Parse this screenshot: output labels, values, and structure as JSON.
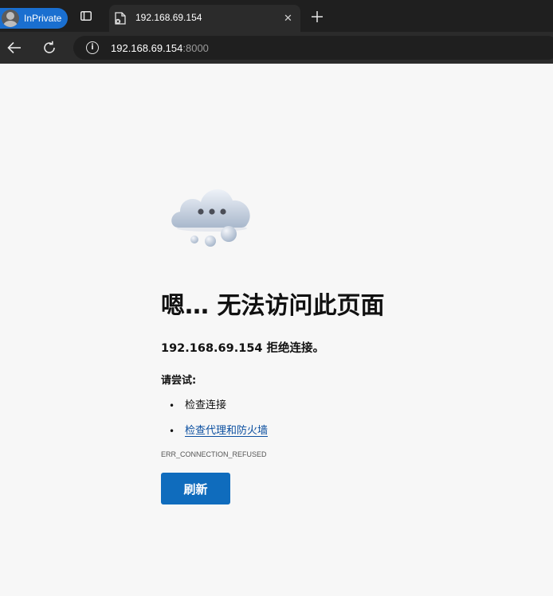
{
  "browser": {
    "inprivate_label": "InPrivate",
    "tab": {
      "title": "192.168.69.154",
      "close_glyph": "✕"
    },
    "address": {
      "host": "192.168.69.154",
      "port": ":8000"
    },
    "accent_color": "#1a6fd0"
  },
  "page": {
    "illustration": "cloud-error-icon",
    "headline": "嗯… 无法访问此页面",
    "subline": "192.168.69.154 拒绝连接。",
    "try_label": "请尝试:",
    "suggestions": [
      {
        "bullet": "•",
        "text": "检查连接",
        "is_link": false
      },
      {
        "bullet": "•",
        "text": "检查代理和防火墙",
        "is_link": true
      }
    ],
    "error_code": "ERR_CONNECTION_REFUSED",
    "refresh_button": "刷新",
    "button_color": "#0f6cbd"
  }
}
